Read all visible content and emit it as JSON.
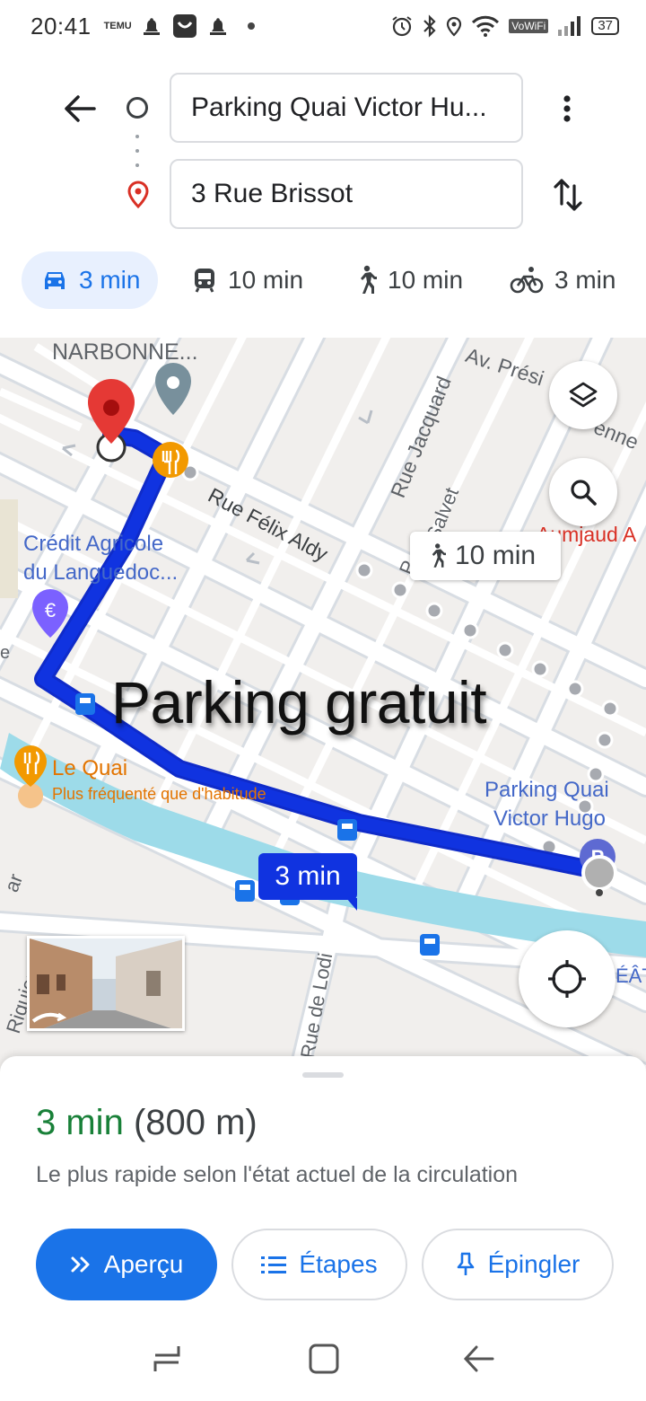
{
  "status_bar": {
    "time": "20:41",
    "temu_label": "TEMU",
    "vowifi_label": "VoWiFi",
    "battery": "37"
  },
  "route": {
    "origin": "Parking Quai Victor Hu...",
    "destination": "3 Rue Brissot"
  },
  "modes": [
    {
      "icon": "car-icon",
      "label": "3 min",
      "active": true
    },
    {
      "icon": "transit-icon",
      "label": "10 min",
      "active": false
    },
    {
      "icon": "walk-icon",
      "label": "10 min",
      "active": false
    },
    {
      "icon": "bike-icon",
      "label": "3 min",
      "active": false
    }
  ],
  "map": {
    "labels": {
      "narbonne": "NARBONNE...",
      "av_president": "Av. Prési",
      "enne": "enne",
      "rue_jacquard": "Rue Jacquard",
      "rue_felix_aldy": "Rue Félix Aldy",
      "salvet": "Salvet",
      "p_short": "P",
      "aumjaud": "Aumjaud A",
      "credit_agricole": "Crédit Agricole",
      "du_languedoc": "du Languedoc...",
      "le_quai": "Le Quai",
      "plus_frequente": "Plus fréquenté que d'habitude",
      "parking_quai": "Parking Quai",
      "victor_hugo": "Victor Hugo",
      "rue_de_lodi": "Rue de Lodi",
      "riquier": "Riquier",
      "ar": "ar",
      "eat": "ÉÂT",
      "e_short": "e"
    },
    "overlay_text": "Parking gratuit",
    "walk_bubble": "10 min",
    "drive_bubble": "3 min",
    "colors": {
      "route": "#1033e0",
      "water": "#9ddbe9",
      "roads": "#ffffff",
      "road_edges": "#d8dde3",
      "background": "#f1efed",
      "pin_red": "#e53935",
      "food_orange": "#f29900"
    }
  },
  "sheet": {
    "eta_time": "3 min",
    "eta_distance": "(800 m)",
    "subtitle": "Le plus rapide selon l'état actuel de la circulation",
    "buttons": {
      "preview": "Aperçu",
      "steps": "Étapes",
      "pin": "Épingler"
    }
  }
}
